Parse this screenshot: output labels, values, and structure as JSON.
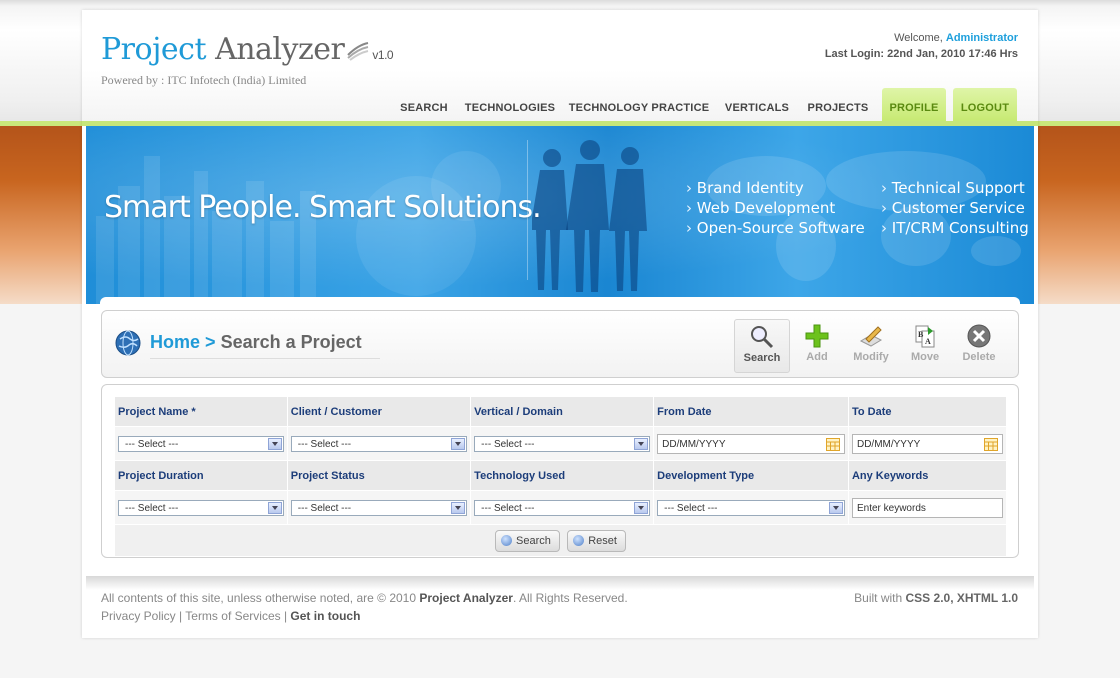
{
  "header": {
    "logo_part1": "Project",
    "logo_part2": "Analyzer",
    "version": "v1.0",
    "powered_by": "Powered by : ITC Infotech (India) Limited",
    "welcome_prefix": "Welcome, ",
    "user": "Administrator",
    "last_login": "Last Login: 22nd Jan, 2010 17:46 Hrs"
  },
  "nav": {
    "items": [
      {
        "label": "SEARCH"
      },
      {
        "label": "TECHNOLOGIES"
      },
      {
        "label": "TECHNOLOGY PRACTICE"
      },
      {
        "label": "VERTICALS"
      },
      {
        "label": "PROJECTS"
      },
      {
        "label": "PROFILE"
      },
      {
        "label": "LOGOUT"
      }
    ]
  },
  "banner": {
    "tagline": "Smart People. Smart Solutions.",
    "services_col1": [
      "Brand Identity",
      "Web Development",
      "Open-Source Software"
    ],
    "services_col2": [
      "Technical Support",
      "Customer Service",
      "IT/CRM Consulting"
    ]
  },
  "page_title": {
    "home": "Home",
    "separator": ">",
    "current": "Search a Project"
  },
  "toolbar": {
    "search": "Search",
    "add": "Add",
    "modify": "Modify",
    "move": "Move",
    "delete": "Delete"
  },
  "form": {
    "row1_labels": [
      "Project Name *",
      "Client / Customer",
      "Vertical / Domain",
      "From Date",
      "To Date"
    ],
    "row2_labels": [
      "Project Duration",
      "Project Status",
      "Technology Used",
      "Development Type",
      "Any Keywords"
    ],
    "select_default": "--- Select ---",
    "date_value": "DD/MM/YYYY",
    "keywords_value": "Enter keywords",
    "search_button": "Search",
    "reset_button": "Reset"
  },
  "footer": {
    "copyright_prefix": "All contents of this site, unless otherwise noted, are © 2010 ",
    "brand": "Project Analyzer",
    "copyright_suffix": ". All Rights Reserved.",
    "privacy": "Privacy Policy",
    "terms": "Terms of Services",
    "contact": "Get in touch",
    "built_prefix": "Built with ",
    "built_tech": "CSS 2.0, XHTML 1.0"
  },
  "colors": {
    "brand_blue": "#1f9ad7",
    "nav_active": "#1f8fd4",
    "green_tab": "#c4e86b",
    "label_navy": "#1c3d7a"
  }
}
